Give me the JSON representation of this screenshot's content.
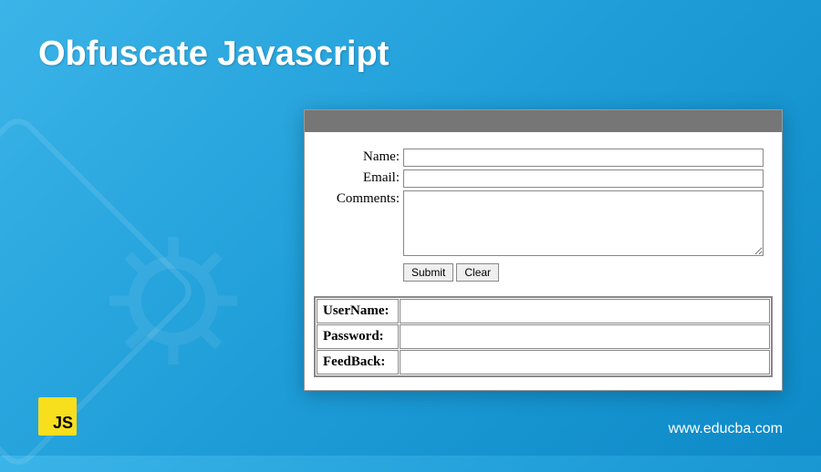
{
  "title": "Obfuscate Javascript",
  "form": {
    "name_label": "Name:",
    "email_label": "Email:",
    "comments_label": "Comments:",
    "submit_label": "Submit",
    "clear_label": "Clear"
  },
  "table": {
    "rows": [
      {
        "label": "UserName:",
        "value": ""
      },
      {
        "label": "Password:",
        "value": ""
      },
      {
        "label": "FeedBack:",
        "value": ""
      }
    ]
  },
  "logo_text": "JS",
  "website": "www.educba.com"
}
